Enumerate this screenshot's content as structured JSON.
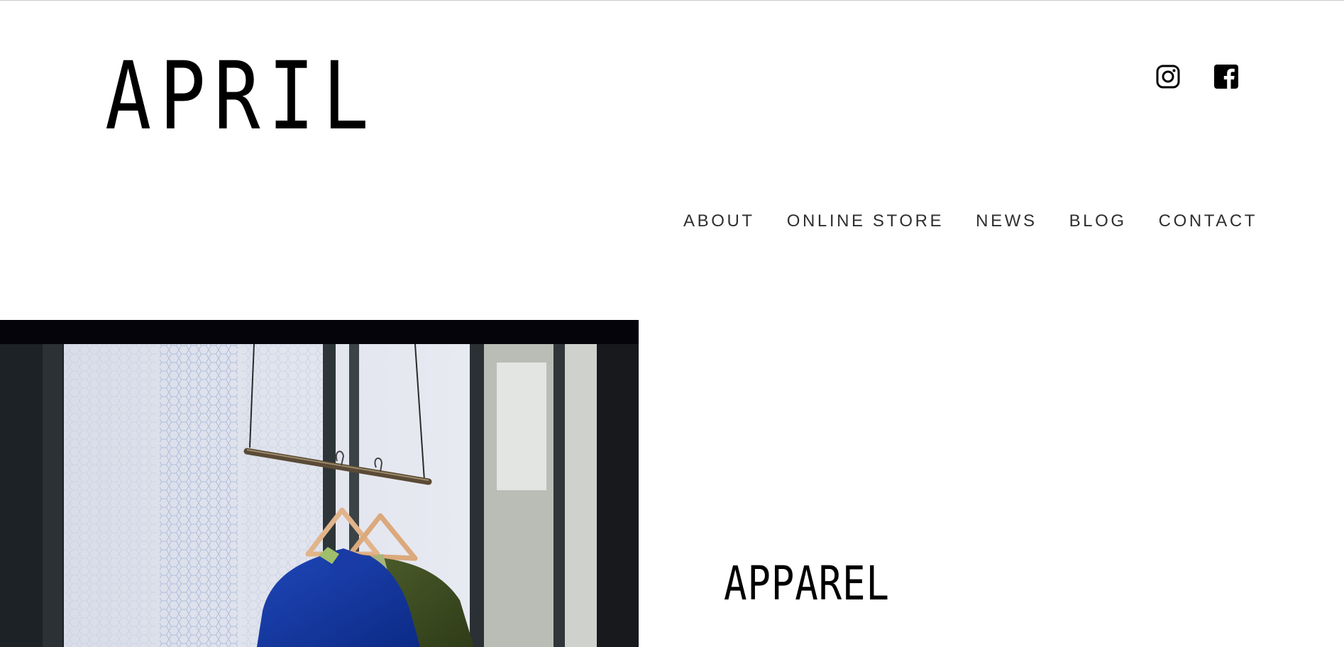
{
  "header": {
    "logo_text": "APRIL",
    "social": [
      {
        "name": "instagram-icon"
      },
      {
        "name": "facebook-icon"
      }
    ]
  },
  "nav": {
    "items": [
      {
        "label": "ABOUT"
      },
      {
        "label": "ONLINE STORE"
      },
      {
        "label": "NEWS"
      },
      {
        "label": "BLOG"
      },
      {
        "label": "CONTACT"
      }
    ]
  },
  "main": {
    "hero_image": "clothing-rack-photo",
    "section_title": "APPAREL"
  },
  "colors": {
    "text": "#000000",
    "nav_text": "#2f2f2f",
    "background": "#ffffff",
    "photo_frame": "#07060c"
  }
}
